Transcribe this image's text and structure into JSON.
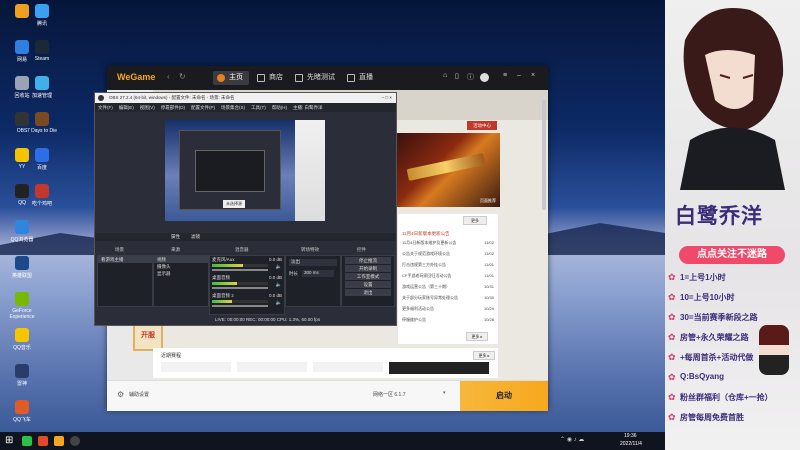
{
  "desktop": {
    "icons": [
      {
        "label": "",
        "color": "#f0a020"
      },
      {
        "label": "腾讯",
        "color": "#3aa0f0"
      },
      {
        "label": "网易",
        "color": "#2f7fe0"
      },
      {
        "label": "Steam",
        "color": "#1b2838"
      },
      {
        "label": "回收站",
        "color": "#9aa3b5"
      },
      {
        "label": "加速管理",
        "color": "#3fb0e8"
      },
      {
        "label": "OBS",
        "color": "#333"
      },
      {
        "label": "7 Days to Die",
        "color": "#7a4b22"
      },
      {
        "label": "YY",
        "color": "#f5c400"
      },
      {
        "label": "百度",
        "color": "#2b6ee8"
      },
      {
        "label": "QQ",
        "color": "#222"
      },
      {
        "label": "吃个鸡吧",
        "color": "#c0392b"
      },
      {
        "label": "QQ浏览器",
        "color": "#2e86de"
      },
      {
        "label": "",
        "color": ""
      },
      {
        "label": "英雄联盟",
        "color": "#1a4a8a"
      },
      {
        "label": "",
        "color": ""
      },
      {
        "label": "GeForce Experience",
        "color": "#76b900"
      },
      {
        "label": "",
        "color": ""
      },
      {
        "label": "QQ音乐",
        "color": "#f7c600"
      },
      {
        "label": "",
        "color": ""
      },
      {
        "label": "雷神",
        "color": "#2a3d6a"
      },
      {
        "label": "",
        "color": ""
      },
      {
        "label": "QQ飞车",
        "color": "#e05a2a"
      }
    ]
  },
  "wegame": {
    "logo": "WeGame",
    "nav": [
      "主页",
      "商店",
      "先睹测试",
      "直播"
    ],
    "activity_button": "活动中心",
    "banner_label": "页面推荐",
    "news_title": "11月4日新版本更新公告",
    "news_items": [
      {
        "text": "11月4日新版本维护及更新公告",
        "date": "11/02"
      },
      {
        "text": "公告关于规范游戏环境公告",
        "date": "11/02"
      },
      {
        "text": "打击违规第三方外挂公告",
        "date": "11/01"
      },
      {
        "text": "CF手游老玩家回归活动公告",
        "date": "11/01"
      },
      {
        "text": "游戏运营公告（第三十期）",
        "date": "10/31"
      },
      {
        "text": "关于部分玩家账号异常处理公告",
        "date": "10/30"
      },
      {
        "text": "更多福利活动公告",
        "date": "10/29"
      },
      {
        "text": "停服维护公告",
        "date": "10/28"
      }
    ],
    "more_label": "更多",
    "more_button": "更多 ▸",
    "recent_title": "近期赛程",
    "recent_more": "更多 ▸",
    "left_badge": "开服",
    "bottom_settings": "辅助设置",
    "bottom_region": "网络一区 6.1.7",
    "launch_button": "启动"
  },
  "obs": {
    "title": "OBS 27.2.4 (64-bit, windows) - 配置文件: 未命名 - 场景: 未命名",
    "menu": [
      "文件(F)",
      "编辑(E)",
      "视图(V)",
      "停靠部件(D)",
      "配置文件(P)",
      "场景集合(S)",
      "工具(T)",
      "帮助(H)",
      "主播: 白鹭乔洋"
    ],
    "preview_label": "未选择源",
    "toolbar_props": "属性",
    "toolbar_filters": "滤镜",
    "docks": {
      "scenes": "场景",
      "sources": "来源",
      "mixer": "混音器",
      "transitions": "转场特效",
      "controls": "控件"
    },
    "scene_items": [
      "看游戏主播"
    ],
    "source_items": [
      "视频",
      "摄像头",
      "显示器"
    ],
    "mixer_tracks": [
      {
        "name": "麦克风/Aux",
        "db": "0.0 dB",
        "level": 0.55
      },
      {
        "name": "桌面音频",
        "db": "0.0 dB",
        "level": 0.45
      },
      {
        "name": "桌面音频 2",
        "db": "0.0 dB",
        "level": 0.35
      }
    ],
    "transition": {
      "type": "淡出",
      "duration_label": "时长",
      "duration": "300 ms"
    },
    "controls": [
      "停止推流",
      "开始录制",
      "工作室模式",
      "设置",
      "退出"
    ],
    "status": "LIVE: 00:00:00  REC: 00:00:00  CPU: 1.3%, 60.00 fps"
  },
  "stream_panel": {
    "name_art": "白鹭乔洋",
    "banner": "点点关注不迷路",
    "lines": [
      "1=上号1小时",
      "10=上号10小时",
      "30=当前赛季新段之路",
      "房管+永久荣耀之路",
      "+每周首杀+活动代做",
      "Q:BsQyang",
      "粉丝群福利（仓库+一抢）",
      "房管每周免费首胜"
    ]
  },
  "taskbar": {
    "time": "19:36",
    "date": "2022/11/4"
  }
}
